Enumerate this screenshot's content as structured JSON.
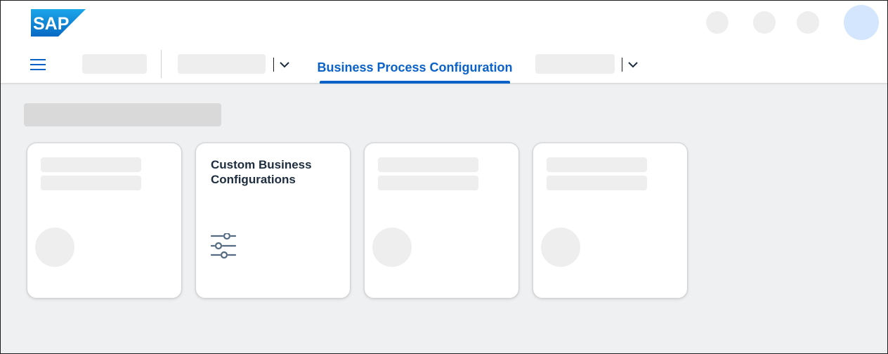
{
  "header": {
    "logo_text": "SAP",
    "nav": {
      "active_tab_label": "Business Process Configuration"
    }
  },
  "tiles": [
    {
      "title": "",
      "icon": "placeholder"
    },
    {
      "title": "Custom Business Configurations",
      "icon": "sliders-icon"
    },
    {
      "title": "",
      "icon": "placeholder"
    },
    {
      "title": "",
      "icon": "placeholder"
    }
  ],
  "colors": {
    "brand": "#0a62c8",
    "avatar": "#d3e6fd",
    "background": "#eff0f2",
    "skeleton": "#eeeeef",
    "tile_text": "#1d2d3e"
  }
}
